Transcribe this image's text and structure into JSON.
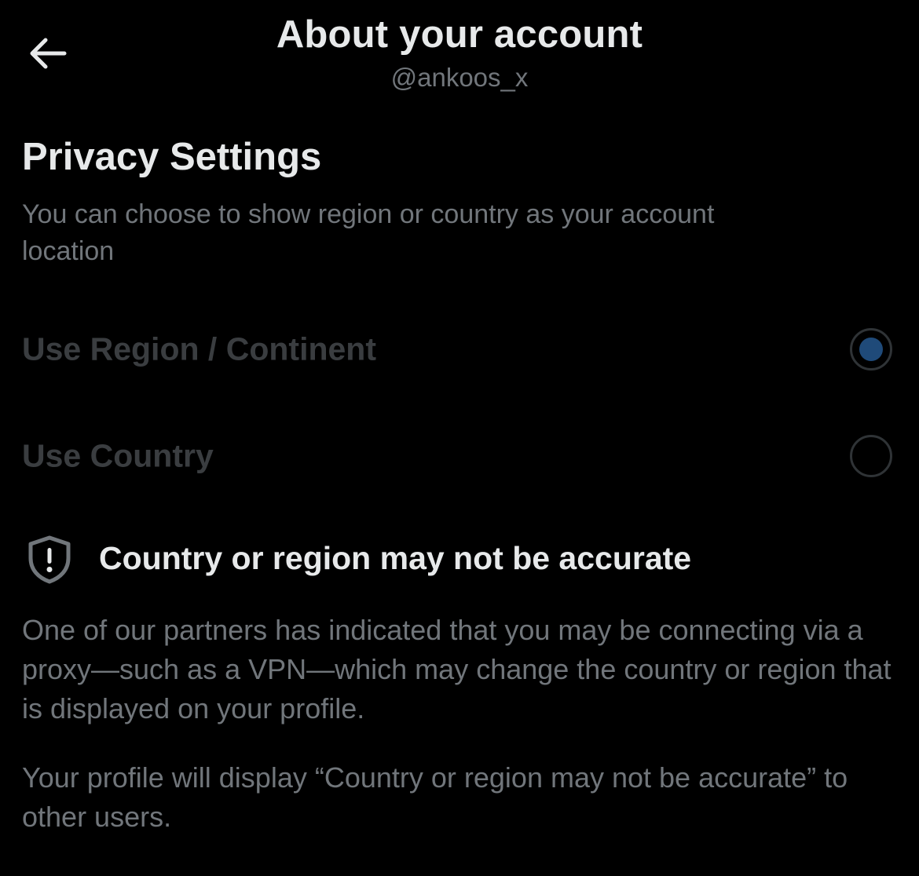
{
  "header": {
    "title": "About your account",
    "handle": "@ankoos_x",
    "back_icon": "arrow-left-icon"
  },
  "privacy": {
    "title": "Privacy Settings",
    "description": "You can choose to show region or country as your account location",
    "options": [
      {
        "label": "Use Region / Continent",
        "selected": true
      },
      {
        "label": "Use Country",
        "selected": false
      }
    ]
  },
  "warning": {
    "icon": "shield-exclamation-icon",
    "title": "Country or region may not be accurate",
    "paragraph1": "One of our partners has indicated that you may be connecting via a proxy—such as a VPN—which may change the country or region that is displayed on your profile.",
    "paragraph2": "Your profile will display “Country or region may not be accurate” to other users."
  },
  "colors": {
    "background": "#000000",
    "primary_text": "#e7e9ea",
    "secondary_text": "#71767b",
    "disabled_text": "#3a3d40",
    "radio_border": "#2f3336",
    "radio_selected": "#1f4a79"
  }
}
